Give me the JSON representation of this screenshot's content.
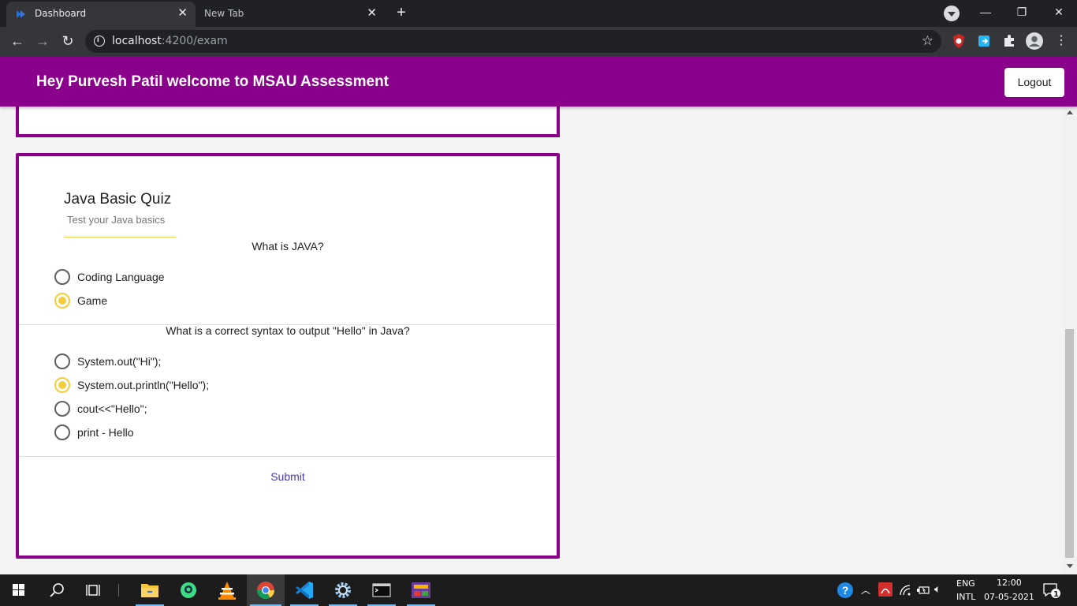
{
  "browser": {
    "tabs": [
      {
        "title": "Dashboard"
      },
      {
        "title": "New Tab"
      }
    ],
    "address": {
      "host": "localhost",
      "path": ":4200/exam"
    }
  },
  "header": {
    "greeting": "Hey Purvesh Patil welcome to MSAU Assessment",
    "logout_label": "Logout",
    "color": "#8b008b"
  },
  "quiz": {
    "title": "Java Basic Quiz",
    "subtitle": "Test your Java basics",
    "questions": [
      {
        "text": "What is JAVA?",
        "options": [
          {
            "label": "Coding Language",
            "selected": false
          },
          {
            "label": "Game",
            "selected": true
          }
        ]
      },
      {
        "text": "What is a correct syntax to output \"Hello\" in Java?",
        "options": [
          {
            "label": "System.out(\"Hi\");",
            "selected": false
          },
          {
            "label": "System.out.println(\"Hello\");",
            "selected": true
          },
          {
            "label": "cout<<\"Hello\";",
            "selected": false
          },
          {
            "label": "print - Hello",
            "selected": false
          }
        ]
      }
    ],
    "submit_label": "Submit",
    "accent_color": "#f5cd3a"
  },
  "taskbar": {
    "apps": [
      "start-icon",
      "search-icon",
      "task-view-icon",
      "file-explorer-icon",
      "android-studio-icon",
      "vlc-icon",
      "chrome-icon",
      "vscode-icon",
      "settings-icon",
      "terminal-icon",
      "game-icon"
    ],
    "language": "ENG",
    "layout": "INTL",
    "time": "12:00",
    "date": "07-05-2021",
    "notifications": "1"
  }
}
